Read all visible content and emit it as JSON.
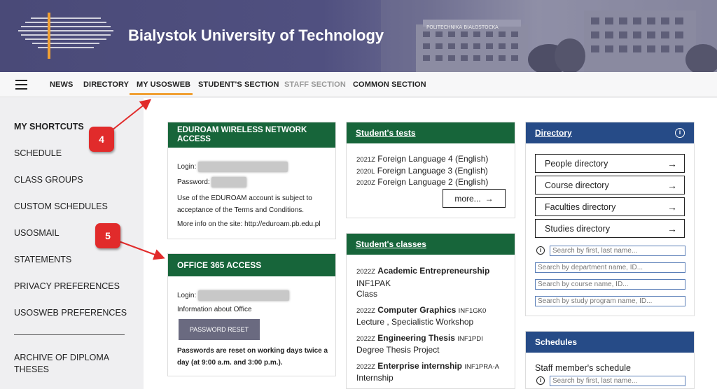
{
  "header": {
    "title": "Bialystok University of Technology",
    "building_sign": "POLITECHNIKA BIAŁOSTOCKA"
  },
  "nav": {
    "items": [
      "NEWS",
      "DIRECTORY",
      "MY USOSWEB",
      "STUDENT'S SECTION",
      "STAFF SECTION",
      "COMMON SECTION"
    ],
    "active": "MY USOSWEB"
  },
  "sidebar": {
    "items": [
      "MY SHORTCUTS",
      "SCHEDULE",
      "CLASS GROUPS",
      "CUSTOM SCHEDULES",
      "USOSMAIL",
      "STATEMENTS",
      "PRIVACY PREFERENCES",
      "USOSWEB PREFERENCES"
    ],
    "archive": "ARCHIVE OF DIPLOMA THESES"
  },
  "eduroam": {
    "title": "EDUROAM WIRELESS NETWORK ACCESS",
    "login_label": "Login:",
    "password_label": "Password:",
    "terms": "Use of the EDUROAM account is subject to acceptance of the Terms and Conditions.",
    "more_info": "More info on the site: http://eduroam.pb.edu.pl"
  },
  "office": {
    "title": "OFFICE 365 ACCESS",
    "login_label": "Login:",
    "info": "Information about Office",
    "reset_button": "PASSWORD RESET",
    "note": "Passwords are reset on working days twice a day (at 9:00 a.m. and 3:00 p.m.)."
  },
  "tests": {
    "title": "Student's tests",
    "items": [
      {
        "term": "2021Z",
        "name": "Foreign Language 4 (English)"
      },
      {
        "term": "2020L",
        "name": "Foreign Language 3 (English)"
      },
      {
        "term": "2020Z",
        "name": "Foreign Language 2 (English)"
      }
    ],
    "more": "more..."
  },
  "classes": {
    "title": "Student's classes",
    "items": [
      {
        "term": "2022Z",
        "name": "Academic Entrepreneurship",
        "code": "INF1PAK",
        "type": "Class"
      },
      {
        "term": "2022Z",
        "name": "Computer Graphics",
        "code": "INF1GK0",
        "type": "Lecture ,  Specialistic Workshop"
      },
      {
        "term": "2022Z",
        "name": "Engineering Thesis",
        "code": "INF1PDI",
        "type": "Degree Thesis Project"
      },
      {
        "term": "2022Z",
        "name": "Enterprise internship",
        "code": "INF1PRA-A",
        "type": "Internship"
      }
    ]
  },
  "directory": {
    "title": "Directory",
    "buttons": [
      "People directory",
      "Course directory",
      "Faculties directory",
      "Studies directory"
    ],
    "placeholders": [
      "Search by first, last name...",
      "Search by department name, ID...",
      "Search by course name, ID...",
      "Search by study program name, ID..."
    ]
  },
  "schedules": {
    "title": "Schedules",
    "staff_label": "Staff member's schedule",
    "placeholder": "Search by first, last name..."
  },
  "annotations": {
    "badge4": "4",
    "badge5": "5",
    "color": "#e12b2b"
  }
}
